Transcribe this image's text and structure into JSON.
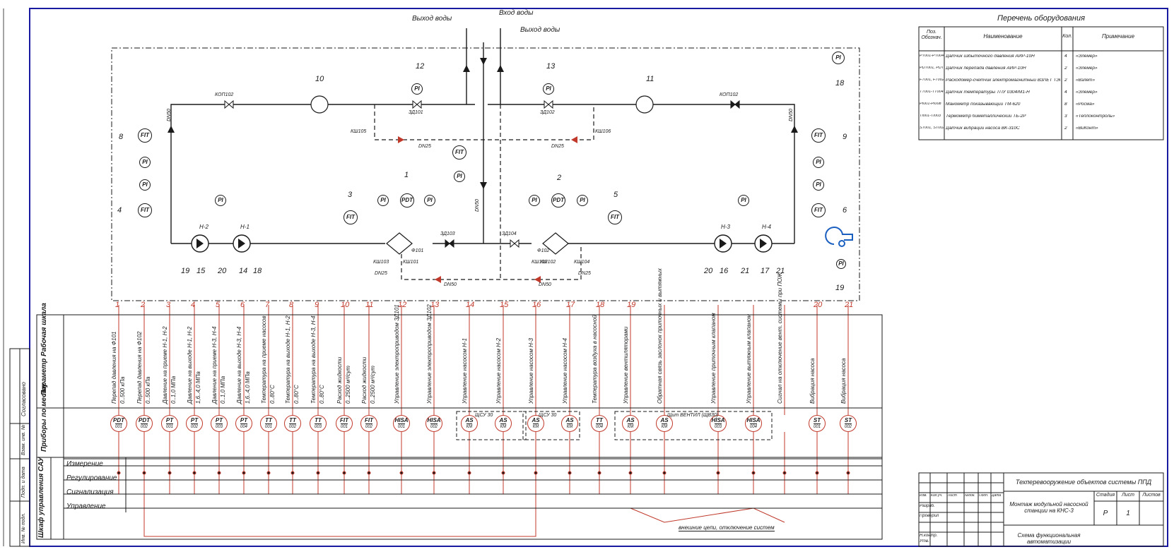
{
  "top": {
    "water_out_1": "Выход воды",
    "water_in": "Вход воды",
    "water_out_2": "Выход воды"
  },
  "equipment_list": {
    "title": "Перечень оборудования",
    "headers": {
      "pos": "Поз. Обознач.",
      "name": "Наименование",
      "qty": "Кол.",
      "note": "Примечание"
    },
    "rows": [
      {
        "pos": "PT001-PT004",
        "name": "Датчик избыточного давления АИР-10Н",
        "qty": "4",
        "note": "«Элемер»"
      },
      {
        "pos": "PDT001, PDT002",
        "name": "Датчик перепада давления АИР-10Н",
        "qty": "2",
        "note": "«Элемер»"
      },
      {
        "pos": "FT001, FT002",
        "name": "Расходомер-счетчик электромагнитный ВЗЛЕТ ТЭР",
        "qty": "2",
        "note": "«Взлет»"
      },
      {
        "pos": "TT001-TT004",
        "name": "Датчик температуры ТПУ 0304/М1-Н",
        "qty": "4",
        "note": "«Элемер»"
      },
      {
        "pos": "PI001-PI008",
        "name": "Манометр показывающий ТМ-620",
        "qty": "8",
        "note": "«Росма»"
      },
      {
        "pos": "TI001-TI003",
        "name": "Термометр биметаллический ТБ-2Р",
        "qty": "3",
        "note": "«Теплоконтроль»"
      },
      {
        "pos": "ST001, ST002",
        "name": "Датчик вибрации насоса ВК-310С",
        "qty": "2",
        "note": "«ВиКонт»"
      }
    ]
  },
  "scheme": {
    "valves": [
      "КОП102",
      "КОП102",
      "ЗД101",
      "ЗД102",
      "ЗД103",
      "ЗД104",
      "КШ105",
      "КШ106",
      "КШ101",
      "КШ102",
      "КШ103",
      "КШ102",
      "КШ104"
    ],
    "filters": [
      "Ф101",
      "Ф102"
    ],
    "pipes": [
      "DN50",
      "DN50",
      "DN25",
      "DN25",
      "DN50",
      "DN25",
      "DN25",
      "DN50",
      "DN50"
    ],
    "pumps": [
      "Н-2",
      "Н-1",
      "Н-3",
      "Н-4"
    ],
    "numbers_top": [
      "10",
      "12",
      "13",
      "11",
      "18",
      "1",
      "2",
      "3",
      "5",
      "7"
    ],
    "numbers_side": [
      "8",
      "4",
      "9",
      "6"
    ],
    "numbers_bottom": [
      "19",
      "15",
      "20",
      "14",
      "18",
      "20",
      "16",
      "21",
      "17",
      "21",
      "19"
    ],
    "inst_labels": [
      "PDT",
      "PDT",
      "FIT",
      "TI",
      "PI",
      "PT"
    ],
    "inst_codes": [
      "001",
      "002",
      "003",
      "004",
      "005",
      "006",
      "007",
      "008"
    ]
  },
  "table": {
    "row_param": "Параметр Рабочая шкала",
    "row_devices": "Приборы по месту",
    "row_cabinet": "Шкаф управления САУ",
    "sau_rows": [
      "Измерение",
      "Регулирование",
      "Сигнализация",
      "Управление"
    ],
    "columns": [
      {
        "n": "1",
        "param": "Перепад давления на Ф101",
        "scale": "0..500 кПа",
        "dev": "PDT",
        "code": "001"
      },
      {
        "n": "2",
        "param": "Перепад давления на Ф102",
        "scale": "0..500 кПа",
        "dev": "PDT",
        "code": "002"
      },
      {
        "n": "3",
        "param": "Давление на приеме Н-1, Н-2",
        "scale": "0..1,0 МПа",
        "dev": "PT",
        "code": "001"
      },
      {
        "n": "4",
        "param": "Давление на выходе Н-1, Н-2",
        "scale": "1,6..4,0 МПа",
        "dev": "PT",
        "code": "002"
      },
      {
        "n": "5",
        "param": "Давление на приеме Н-3, Н-4",
        "scale": "0..1,0 МПа",
        "dev": "PT",
        "code": "003"
      },
      {
        "n": "6",
        "param": "Давление на выходе Н-3, Н-4",
        "scale": "1,6..4,0 МПа",
        "dev": "PT",
        "code": "004"
      },
      {
        "n": "7",
        "param": "Температура на приеме насосов",
        "scale": "0..80°C",
        "dev": "TT",
        "code": "001"
      },
      {
        "n": "8",
        "param": "Температура на выходе Н-1, Н-2",
        "scale": "0..80°C",
        "dev": "TT",
        "code": "002"
      },
      {
        "n": "9",
        "param": "Температура на выходе Н-3, Н-4",
        "scale": "0..80°C",
        "dev": "TT",
        "code": "003"
      },
      {
        "n": "10",
        "param": "Расход жидкости",
        "scale": "0..2500 м³/сут",
        "dev": "FIT",
        "code": "001"
      },
      {
        "n": "11",
        "param": "Расход жидкости",
        "scale": "0..2500 м³/сут",
        "dev": "FIT",
        "code": "002"
      },
      {
        "n": "12",
        "param": "Управление электроприводом ЗД101",
        "scale": "",
        "dev": "HISA",
        "code": "001"
      },
      {
        "n": "13",
        "param": "Управление электроприводом ЗД102",
        "scale": "",
        "dev": "HISA",
        "code": "002"
      },
      {
        "n": "14",
        "param": "Управление насосом Н-1",
        "scale": "",
        "dev": "AS",
        "code": "КМ"
      },
      {
        "n": "15",
        "param": "Управление насосом Н-2",
        "scale": "",
        "dev": "AS",
        "code": "КМ"
      },
      {
        "n": "16",
        "param": "Управление насосом Н-3",
        "scale": "",
        "dev": "AS",
        "code": "КМ"
      },
      {
        "n": "17",
        "param": "Управление насосом Н-4",
        "scale": "",
        "dev": "AS",
        "code": "КМ"
      },
      {
        "n": "18",
        "param": "Температура воздуха в насосной",
        "scale": "",
        "dev": "TT",
        "code": "004"
      },
      {
        "n": "19",
        "param": "Управление вентиляторами",
        "scale": "",
        "dev": "AS",
        "code": "КМ"
      },
      {
        "n": "",
        "param": "Обратная связь заслонок приточных и вытяжных",
        "scale": "",
        "dev": "AS",
        "code": "КМ"
      },
      {
        "n": "",
        "param": "Управление приточным клапаном",
        "scale": "",
        "dev": "HISA",
        "code": "003"
      },
      {
        "n": "",
        "param": "Управление вытяжным клапаном",
        "scale": "",
        "dev": "HISA",
        "code": "004"
      },
      {
        "n": "",
        "param": "Сигнал на отключение вент. системы при ПОЖ",
        "scale": "",
        "dev": "",
        "code": ""
      },
      {
        "n": "20",
        "param": "Вибрация насоса",
        "scale": "",
        "dev": "ST",
        "code": "001"
      },
      {
        "n": "21",
        "param": "Вибрация насоса",
        "scale": "",
        "dev": "ST",
        "code": "002"
      }
    ],
    "group_labels": [
      "ШУ",
      "ЩСУ 30",
      "ЩСУ 30",
      "Щит ВЕНТИЛ (ЩВ30)"
    ],
    "bottom_note": "внешние цепи, отключение систем"
  },
  "stamp": {
    "title1": "Техперевооружение объектов системы ППД",
    "title2": "Монтаж модульной насосной станции на КНС-3",
    "title3": "Схема функциональная автоматизации",
    "stage_h": "Стадия",
    "sheet_h": "Лист",
    "sheets_h": "Листов",
    "stage": "Р",
    "sheet": "1",
    "roles": [
      "Разраб.",
      "Проверил",
      "Н.контр.",
      "Утв."
    ],
    "cols": [
      "Изм.",
      "Кол.уч.",
      "Лист",
      "№док.",
      "Подп.",
      "Дата"
    ]
  },
  "left_strip": [
    "Согласовано",
    "Взам. инв. №",
    "Подп. и дата",
    "Инв. № подл."
  ]
}
